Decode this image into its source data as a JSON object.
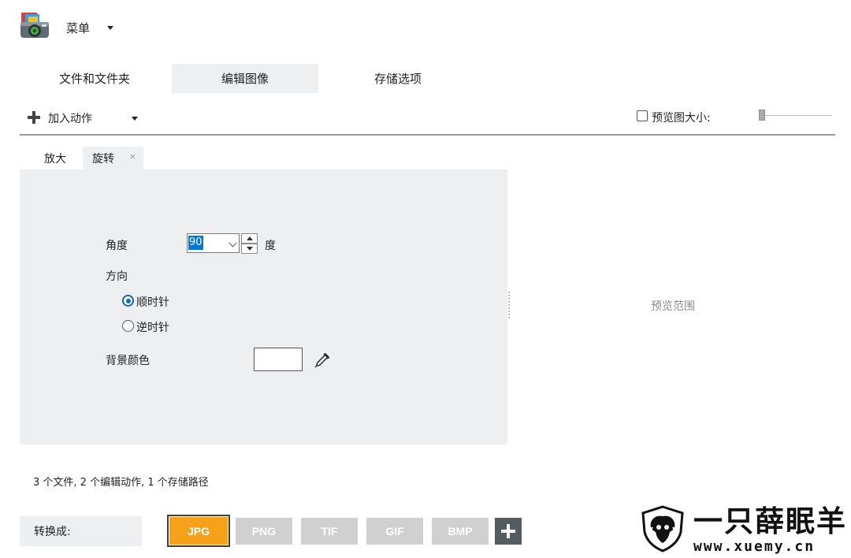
{
  "menu": {
    "label": "菜单"
  },
  "main_tabs": [
    {
      "label": "文件和文件夹",
      "active": false
    },
    {
      "label": "编辑图像",
      "active": true
    },
    {
      "label": "存储选项",
      "active": false
    }
  ],
  "toolbar": {
    "add_action_label": "加入动作",
    "preview_size_label": "预览图大小:",
    "preview_size_checked": false
  },
  "sub_tabs": [
    {
      "label": "放大",
      "active": false
    },
    {
      "label": "旋转",
      "active": true,
      "close": "×"
    }
  ],
  "rotate": {
    "angle_label": "角度",
    "angle_value": "90",
    "angle_unit": "度",
    "direction_label": "方向",
    "options": [
      {
        "label": "顺时针",
        "selected": true
      },
      {
        "label": "逆时针",
        "selected": false
      }
    ],
    "bg_color_label": "背景颜色",
    "bg_color": "#ffffff"
  },
  "preview": {
    "area_label": "预览范围"
  },
  "footer": {
    "summary": "3 个文件, 2 个编辑动作, 1 个存储路径",
    "convert_label": "转换成:",
    "formats": [
      "JPG",
      "PNG",
      "TIF",
      "GIF",
      "BMP"
    ],
    "active_format": "JPG",
    "accent_color": "#f7a01a"
  },
  "watermark": {
    "name": "一只薛眠羊",
    "url": "www.xuemy.cn"
  }
}
